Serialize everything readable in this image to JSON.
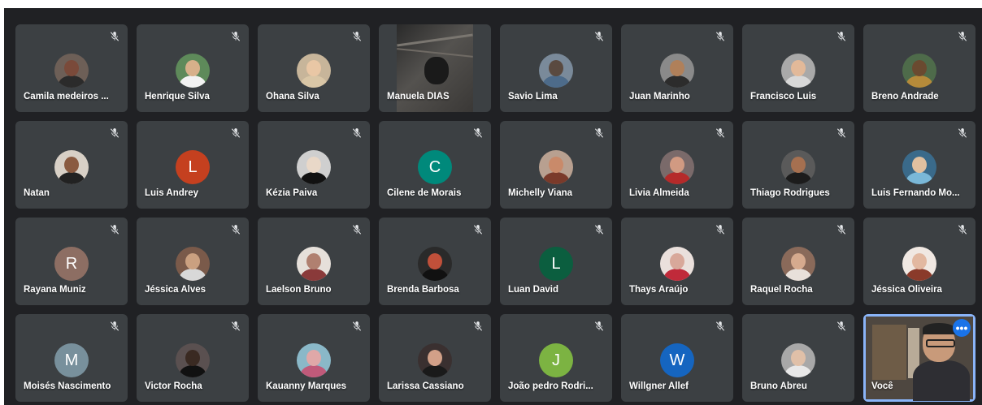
{
  "participants": [
    {
      "name": "Camila medeiros ...",
      "avatar": "photo",
      "skin": "#7a4a3a",
      "shirt": "#2b2b2b",
      "bg": "#6d5f57"
    },
    {
      "name": "Henrique Silva",
      "avatar": "photo",
      "skin": "#d7b08a",
      "shirt": "#f2f2f2",
      "bg": "#5e8a5a"
    },
    {
      "name": "Ohana Silva",
      "avatar": "photo",
      "skin": "#e9c7a5",
      "shirt": "#d9c6a6",
      "bg": "#c7b59a"
    },
    {
      "name": "Manuela DIAS",
      "avatar": "video"
    },
    {
      "name": "Savio Lima",
      "avatar": "photo",
      "skin": "#5a4a40",
      "shirt": "#4d6b8a",
      "bg": "#7a8a9a"
    },
    {
      "name": "Juan Marinho",
      "avatar": "photo",
      "skin": "#b0805a",
      "shirt": "#2c2c2c",
      "bg": "#8a8a8a"
    },
    {
      "name": "Francisco Luis",
      "avatar": "photo",
      "skin": "#e2b999",
      "shirt": "#d8d8d8",
      "bg": "#a9a9a9"
    },
    {
      "name": "Breno Andrade",
      "avatar": "photo",
      "skin": "#6a4a30",
      "shirt": "#b58a3a",
      "bg": "#4e6b4a"
    },
    {
      "name": "Natan",
      "avatar": "photo",
      "skin": "#8a5a40",
      "shirt": "#222222",
      "bg": "#d8d0c6"
    },
    {
      "name": "Luis Andrey",
      "avatar": "letter",
      "letter": "L",
      "color": "#c5401f"
    },
    {
      "name": "Kézia Paiva",
      "avatar": "photo",
      "skin": "#e9d8c8",
      "shirt": "#111111",
      "bg": "#cfcfcf"
    },
    {
      "name": "Cilene de Morais",
      "avatar": "letter",
      "letter": "C",
      "color": "#00897b"
    },
    {
      "name": "Michelly Viana",
      "avatar": "photo",
      "skin": "#c98a6a",
      "shirt": "#7a3a2a",
      "bg": "#b8a090"
    },
    {
      "name": "Livia Almeida",
      "avatar": "photo",
      "skin": "#d19a82",
      "shirt": "#b52a2a",
      "bg": "#7a6a6a"
    },
    {
      "name": "Thiago Rodrigues",
      "avatar": "photo",
      "skin": "#a67050",
      "shirt": "#1c1c1c",
      "bg": "#5a5a5a"
    },
    {
      "name": "Luis Fernando Mo...",
      "avatar": "photo",
      "skin": "#e0c0a0",
      "shirt": "#7ab8d8",
      "bg": "#3a6a8a"
    },
    {
      "name": "Rayana Muniz",
      "avatar": "letter",
      "letter": "R",
      "color": "#8d6e63"
    },
    {
      "name": "Jéssica Alves",
      "avatar": "photo",
      "skin": "#caa080",
      "shirt": "#d8d8d8",
      "bg": "#7a5a4a"
    },
    {
      "name": "Laelson Bruno",
      "avatar": "photo",
      "skin": "#b08070",
      "shirt": "#8a3a3a",
      "bg": "#e6e0da"
    },
    {
      "name": "Brenda Barbosa",
      "avatar": "photo",
      "skin": "#c0503a",
      "shirt": "#111111",
      "bg": "#2a2a2a"
    },
    {
      "name": "Luan David",
      "avatar": "letter",
      "letter": "L",
      "color": "#0b5e3f"
    },
    {
      "name": "Thays Araújo",
      "avatar": "photo",
      "skin": "#d8a89a",
      "shirt": "#c02a3a",
      "bg": "#eae0dc"
    },
    {
      "name": "Raquel Rocha",
      "avatar": "photo",
      "skin": "#d6aa8e",
      "shirt": "#e8e0da",
      "bg": "#8a6a5a"
    },
    {
      "name": "Jéssica Oliveira",
      "avatar": "photo",
      "skin": "#e2b8a0",
      "shirt": "#8a3a2a",
      "bg": "#f0e8e2"
    },
    {
      "name": "Moisés Nascimento",
      "avatar": "letter",
      "letter": "M",
      "color": "#78909c"
    },
    {
      "name": "Victor Rocha",
      "avatar": "photo",
      "skin": "#3a2a22",
      "shirt": "#111111",
      "bg": "#5a5050"
    },
    {
      "name": "Kauanny Marques",
      "avatar": "photo",
      "skin": "#e0a8a8",
      "shirt": "#c05a7a",
      "bg": "#8ab8c8"
    },
    {
      "name": "Larissa Cassiano",
      "avatar": "photo",
      "skin": "#d2a088",
      "shirt": "#1a1a1a",
      "bg": "#3a3030"
    },
    {
      "name": "João pedro Rodri...",
      "avatar": "letter",
      "letter": "J",
      "color": "#7cb342"
    },
    {
      "name": "Willgner Allef",
      "avatar": "letter",
      "letter": "W",
      "color": "#1565c0"
    },
    {
      "name": "Bruno Abreu",
      "avatar": "photo",
      "skin": "#e0c0a8",
      "shirt": "#e8e8e8",
      "bg": "#a8a8a8"
    },
    {
      "name": "Você",
      "avatar": "self"
    }
  ],
  "colors": {
    "background": "#202124",
    "tile": "#3c4043",
    "self_border": "#8ab4f8",
    "more_button": "#1a73e8"
  },
  "icons": {
    "mic": "mic-off-icon",
    "more": "more-options-icon"
  },
  "more_button_label": "•••"
}
